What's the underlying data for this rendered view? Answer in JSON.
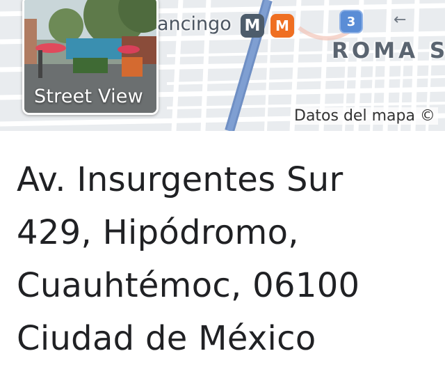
{
  "map": {
    "street_label": "ancingo",
    "metro_badge": "M",
    "metro_logo": "M",
    "line_badge": "3",
    "neighborhood": "ROMA S",
    "attribution": "Datos del mapa ©"
  },
  "street_view": {
    "label": "Street View"
  },
  "address": {
    "lines": [
      "Av. Insurgentes Sur",
      "429, Hipódromo,",
      "Cuauhtémoc, 06100",
      "Ciudad de México"
    ]
  },
  "colors": {
    "map_bg": "#e9ecef",
    "road_major": "#6f8fc4",
    "metro_gray": "#4d5c6b",
    "metro_orange": "#ef6f22",
    "line_blue": "#5a8dd6",
    "text": "#202124"
  }
}
